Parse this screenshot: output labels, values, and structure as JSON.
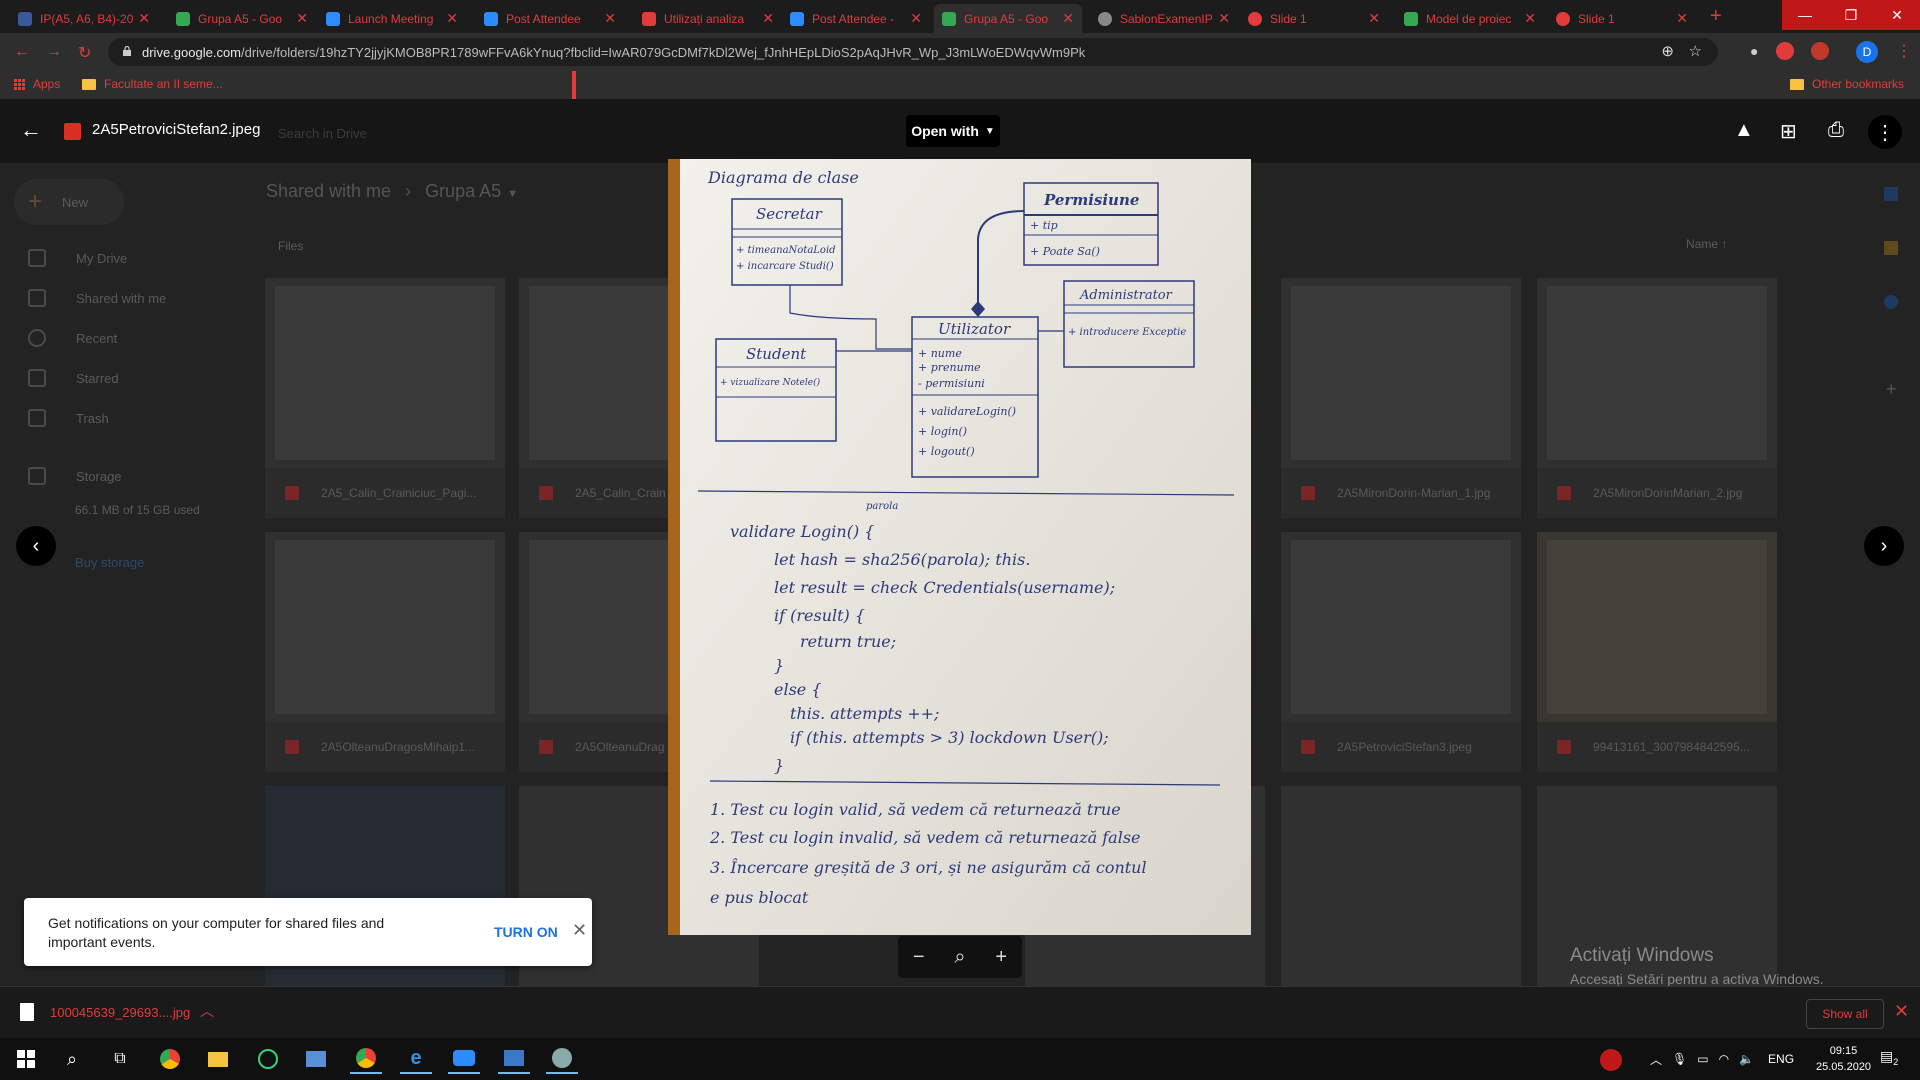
{
  "browser": {
    "tabs": [
      {
        "label": "IP(A5, A6, B4)-20",
        "color": "#3b5998"
      },
      {
        "label": "Grupa A5 - Goo",
        "color": "#34a853"
      },
      {
        "label": "Launch Meeting",
        "color": "#2d8cff"
      },
      {
        "label": "Post Attendee",
        "color": "#2d8cff"
      },
      {
        "label": "Utilizați analiza",
        "color": "#e23b3b"
      },
      {
        "label": "Post Attendee -",
        "color": "#2d8cff"
      },
      {
        "label": "Grupa A5 - Goo",
        "color": "#34a853"
      },
      {
        "label": "SablonExamenIP",
        "color": "#888888"
      },
      {
        "label": "Slide 1",
        "color": "#e23b3b"
      },
      {
        "label": "Model de proiec",
        "color": "#34a853"
      },
      {
        "label": "Slide 1",
        "color": "#e23b3b"
      }
    ],
    "url_host": "drive.google.com",
    "url_path": "/drive/folders/19hzTY2jjyjKMOB8PR1789wFFvA6kYnuq?fbclid=IwAR079GcDMf7kDl2Wej_fJnhHEpLDioS2pAqJHvR_Wp_J3mLWoEDWqvWm9Pk",
    "bookmarks": {
      "apps": "Apps",
      "folder": "Facultate an II seme...",
      "other": "Other bookmarks"
    },
    "profile_initial": "D"
  },
  "drive": {
    "search_placeholder": "Search in Drive",
    "new_label": "New",
    "sidebar": [
      "My Drive",
      "Shared with me",
      "Recent",
      "Starred",
      "Trash"
    ],
    "storage_label": "Storage",
    "storage_used": "66.1 MB of 15 GB used",
    "buy_storage": "Buy storage",
    "breadcrumb_root": "Shared with me",
    "breadcrumb_folder": "Grupa A5",
    "files_label": "Files",
    "sort_label": "Name",
    "thumb_captions": [
      "2A5_Calin_Crainiciuc_Pagi...",
      "2A5_Calin_Crain",
      "2A5MironDorin-Marian_1.jpg",
      "2A5MironDorinMarian_2.jpg",
      "2A5OlteanuDragosMihaip1...",
      "2A5OlteanuDrag",
      "2A5PetroviciStefan3.jpeg",
      "99413161_3007984842595..."
    ]
  },
  "viewer": {
    "filename": "2A5PetroviciStefan2.jpeg",
    "open_with": "Open with"
  },
  "handwriting": {
    "title": "Diagrama de clase",
    "class_secretar": "Secretar",
    "secretar_ops": [
      "+ timeanaNotaLoid",
      "+ incarcare Studi()"
    ],
    "class_permisiune": "Permisiune",
    "permisiune_attr": "+ tip",
    "permisiune_op": "+ Poate Sa()",
    "class_student": "Student",
    "student_op": "+ vizualizare Notele()",
    "class_utilizator": "Utilizator",
    "utilizator_attrs": [
      "+ nume",
      "+ prenume",
      "- permisiuni"
    ],
    "utilizator_ops": [
      "+ validareLogin()",
      "+ login()",
      "+ logout()"
    ],
    "class_administrator": "Administrator",
    "administrator_op": "+ introducere Exceptie",
    "code": [
      "validare Login() {",
      "let hash = sha256(parola); this.",
      "let result = check Credentials(username);",
      "if (result) {",
      "return true;",
      "}",
      "else {",
      "this. attempts ++;",
      "if (this. attempts > 3) lockdown User();",
      "}"
    ],
    "code_note": "parola",
    "tests": [
      "1. Test cu login valid, să vedem că returnează true",
      "2. Test cu login invalid, să vedem că returnează false",
      "3. Încercare greșită de 3 ori, și ne asigurăm că contul",
      "e pus blocat"
    ]
  },
  "notification": {
    "text": "Get notifications on your computer for shared files and important events.",
    "action": "TURN ON"
  },
  "watermark": {
    "line1": "Activați Windows",
    "line2": "Accesați Setări pentru a activa Windows."
  },
  "downloads": {
    "file": "100045639_29693....jpg",
    "show_all": "Show all"
  },
  "taskbar": {
    "language": "ENG",
    "time": "09:15",
    "date": "25.05.2020",
    "notification_count": "2"
  }
}
